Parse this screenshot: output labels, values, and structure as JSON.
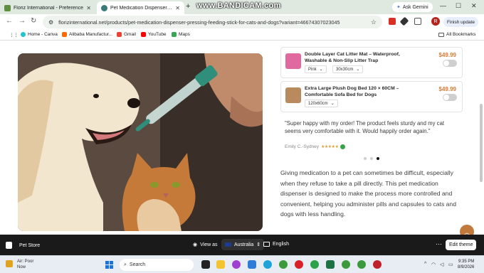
{
  "browser": {
    "tabs": [
      {
        "title": "Floriz International - Preference",
        "active": false
      },
      {
        "title": "Pet Medication Dispenser – Eas",
        "active": true
      }
    ],
    "watermark": "www.BANDICAM.com",
    "gemini_label": "Ask Gemini",
    "url": "florizinternational.net/products/pet-medication-dispenser-pressing-feeding-stick-for-cats-and-dogs?variant=46674307023045",
    "profile_initial": "R",
    "finish_update_label": "Finish update",
    "bookmarks": [
      {
        "label": "Home - Canva",
        "color": "#20c4cb"
      },
      {
        "label": "Alibaba Manufactur...",
        "color": "#ff6a00"
      },
      {
        "label": "Gmail",
        "color": "#ea4335"
      },
      {
        "label": "YouTube",
        "color": "#ff0000"
      },
      {
        "label": "Maps",
        "color": "#34a853"
      }
    ],
    "all_bookmarks_label": "All Bookmarks"
  },
  "page": {
    "upsells": [
      {
        "name": "Double Layer Cat Litter Mat – Waterproof, Washable & Non-Slip Litter Trap",
        "price": "$49.99",
        "options": [
          "Pink",
          "30x30cm"
        ],
        "thumb_color": "#e06aa0"
      },
      {
        "name": "Extra Large Plush Dog Bed 120 × 60CM – Comfortable Sofa Bed for Dogs",
        "price": "$49.99",
        "options": [
          "120x60cm"
        ],
        "thumb_color": "#b88a5e"
      }
    ],
    "review": {
      "text": "\"Super happy with my order! The product feels sturdy and my cat seems very comfortable with it. Would happily order again.\"",
      "author": "Emily C.-Sydney",
      "stars": "★★★★★",
      "rating": 5
    },
    "carousel": {
      "count": 3,
      "active_index": 2
    },
    "description": "Giving medication to a pet can sometimes be difficult, especially when they refuse to take a pill directly. This pet medication dispenser is designed to make the process more controlled and convenient, helping you administer pills and capsules to cats and dogs with less handling."
  },
  "preview_bar": {
    "store_name": "Pet Store",
    "view_as_label": "View as",
    "country": "Australia",
    "language": "English",
    "edit_theme_label": "Edit theme"
  },
  "taskbar": {
    "weather_line1": "Air: Poor",
    "weather_line2": "Now",
    "search_placeholder": "Search",
    "time": "9:35 PM",
    "date": "8/9/2026"
  },
  "colors": {
    "accent_price": "#d97a34",
    "preview_bar_bg": "#1a1a1a",
    "scroll_top_button": "#c27a3c"
  }
}
